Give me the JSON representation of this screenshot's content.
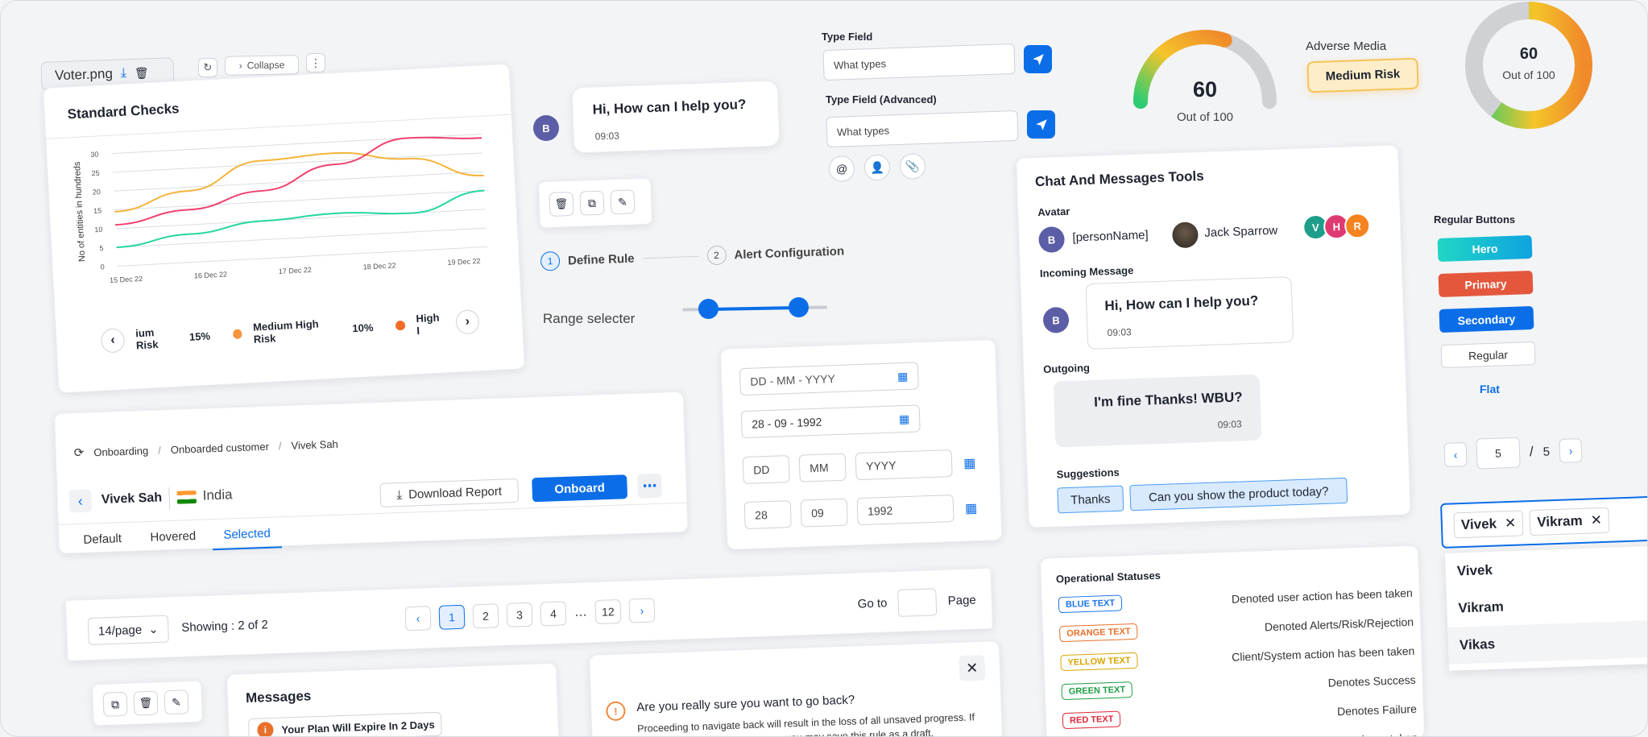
{
  "file_chip": {
    "name": "Voter.png"
  },
  "toolbar": {
    "collapse_label": "Collapse"
  },
  "standard_checks": {
    "title": "Standard Checks"
  },
  "chart_data": {
    "type": "line",
    "x": [
      "15 Dec 22",
      "16 Dec 22",
      "17 Dec 22",
      "18 Dec 22",
      "19 Dec 22"
    ],
    "ylabel": "No of entities in hundreds",
    "ylim": [
      0,
      30
    ],
    "yticks": [
      0,
      5,
      10,
      15,
      20,
      25,
      30
    ],
    "grid": true,
    "series": [
      {
        "color": "#f5b43c",
        "values": [
          14.5,
          19,
          26,
          27,
          24.5,
          19
        ]
      },
      {
        "color": "#f0416c",
        "values": [
          11,
          14,
          18,
          24,
          30,
          29
        ]
      },
      {
        "color": "#25d6a0",
        "values": [
          5,
          7.5,
          10,
          11,
          10,
          15
        ]
      }
    ],
    "legend": [
      {
        "label": "ium Risk",
        "pct": "15%"
      },
      {
        "label": "Medium High Risk",
        "pct": "10%",
        "color": "#f7943e"
      },
      {
        "label": "High I",
        "color": "#f26c2a"
      }
    ]
  },
  "chat_bubble_top": {
    "avatar": "B",
    "text": "Hi, How can I help you?",
    "time": "09:03"
  },
  "stepper": {
    "steps": [
      {
        "num": "1",
        "label": "Define Rule"
      },
      {
        "num": "2",
        "label": "Alert Configuration"
      }
    ]
  },
  "range": {
    "label": "Range selecter",
    "low": 0.18,
    "high": 0.8
  },
  "type_field": {
    "label": "Type Field",
    "placeholder": "What types",
    "label_adv": "Type Field (Advanced)",
    "placeholder_adv": "What types"
  },
  "gauge1": {
    "value": "60",
    "caption": "Out of 100",
    "fraction": 0.6
  },
  "adverse": {
    "label": "Adverse Media",
    "badge": "Medium Risk"
  },
  "gauge2": {
    "value": "60",
    "caption": "Out of 100",
    "fraction": 0.6
  },
  "breadcrumb_card": {
    "crumbs": [
      "Onboarding",
      "Onboarded customer",
      "Vivek Sah"
    ],
    "name": "Vivek Sah",
    "country": "India",
    "download_label": "Download Report",
    "onboard_label": "Onboard",
    "tabs": [
      "Default",
      "Hovered",
      "Selected"
    ]
  },
  "dates": {
    "placeholder": "DD - MM - YYYY",
    "value": "28 - 09 - 1992",
    "dd_ph": "DD",
    "mm_ph": "MM",
    "yyyy_ph": "YYYY",
    "dd": "28",
    "mm": "09",
    "yyyy": "1992"
  },
  "chat_tools": {
    "title": "Chat And Messages Tools",
    "avatar_label": "Avatar",
    "person_placeholder": "[personName]",
    "person_b": "B",
    "jack": "Jack Sparrow",
    "group": [
      {
        "l": "V",
        "c": "#1e9e8a"
      },
      {
        "l": "H",
        "c": "#e03a72"
      },
      {
        "l": "R",
        "c": "#f5841f"
      }
    ],
    "incoming_label": "Incoming Message",
    "incoming_text": "Hi, How can I help you?",
    "incoming_time": "09:03",
    "outgoing_label": "Outgoing",
    "outgoing_text": "I'm fine Thanks! WBU?",
    "outgoing_time": "09:03",
    "suggestions_label": "Suggestions",
    "suggestions": [
      "Thanks",
      "Can you show the product today?"
    ]
  },
  "regular_buttons": {
    "title": "Regular Buttons",
    "hero": "Hero",
    "primary": "Primary",
    "secondary": "Secondary",
    "regular": "Regular",
    "flat": "Flat"
  },
  "mini_pager": {
    "current": "5",
    "sep": "/",
    "total": "5"
  },
  "multi_select": {
    "tags": [
      "Vivek",
      "Vikram"
    ],
    "options": [
      "Vivek",
      "Vikram",
      "Vikas"
    ]
  },
  "pagination": {
    "per_page": "14/page",
    "showing": "Showing : 2 of 2",
    "pages": [
      "1",
      "2",
      "3",
      "4",
      "…",
      "12"
    ],
    "goto": "Go to",
    "page": "Page"
  },
  "messages": {
    "title": "Messages",
    "banner": "Your Plan Will Expire In 2 Days"
  },
  "dialog": {
    "question": "Are you really sure you want to go back?",
    "body": "Proceeding to navigate back will result in the loss of all unsaved progress. If",
    "body2": "you may save this rule as a draft."
  },
  "statuses": {
    "title": "Operational Statuses",
    "items": [
      {
        "tag": "BLUE TEXT",
        "color": "#1a73e8",
        "desc": "Denoted user action has been taken"
      },
      {
        "tag": "ORANGE TEXT",
        "color": "#e8702a",
        "desc": "Denoted Alerts/Risk/Rejection"
      },
      {
        "tag": "YELLOW TEXT",
        "color": "#d9a400",
        "desc": "Client/System action has been taken"
      },
      {
        "tag": "GREEN TEXT",
        "color": "#1e9e46",
        "desc": "Denotes Success"
      },
      {
        "tag": "RED TEXT",
        "color": "#e0283a",
        "desc": "Denotes Failure"
      },
      {
        "tag": "",
        "color": "#888888",
        "desc": "No action has been taken"
      }
    ]
  }
}
